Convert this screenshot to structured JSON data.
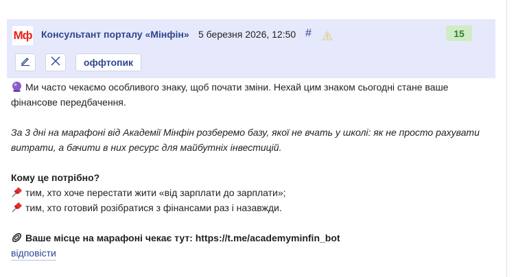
{
  "post": {
    "author": "Консультант порталу «Мінфін»",
    "avatar_text": "Мф",
    "date": "5 березня 2026, 12:50",
    "permalink": "#",
    "warn_icon": "warning-triangle-icon",
    "votes": "15",
    "actions": {
      "edit_icon": "pencil-icon",
      "close_icon": "close-icon",
      "offtopic_label": "оффтопик"
    },
    "colors": {
      "header_bg": "#e6e9fb",
      "author": "#2e4490",
      "avatar_brand": "#e8231b",
      "votes_bg": "#cfedc4",
      "votes_text": "#2e7d32"
    }
  },
  "content": {
    "intro_icon": "crystal-ball-icon",
    "intro": "Ми часто чекаємо особливого знаку, щоб почати зміни. Нехай цим знаком сьогодні стане ваше фінансове передбачення.",
    "italic": "За 3 дні на марафоні від Академії Мінфін розберемо базу, якої не вчать у школі: як не просто рахувати витрати, а бачити в них ресурс для майбутніх інвестицій.",
    "who_heading": "Кому це потрібно?",
    "bullet_icon": "pushpin-icon",
    "bullets": [
      "тим, хто хоче перестати жити «від зарплати до зарплати»;",
      "тим, хто готовий розібратися з фінансами раз і назавжди."
    ],
    "cta_icon": "paperclip-icon",
    "cta": "Ваше місце на марафоні чекає тут: https://t.me/academyminfin_bot"
  },
  "reply_label": "відповісти"
}
